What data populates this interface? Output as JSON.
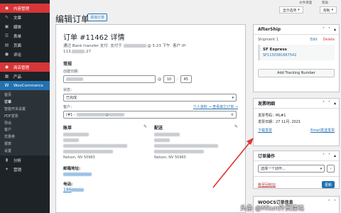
{
  "top_links": [
    "文件清理",
    "帮助"
  ],
  "screen_options_label": "显示选项",
  "help_label": "帮助",
  "sidebar": {
    "items_top": [
      {
        "label": "内容管理",
        "icon": "dashboard-icon",
        "state": "active"
      },
      {
        "label": "文章",
        "icon": "pin-icon"
      },
      {
        "label": "媒体",
        "icon": "media-icon"
      },
      {
        "label": "表单",
        "icon": "form-icon"
      },
      {
        "label": "页面",
        "icon": "page-icon"
      },
      {
        "label": "评论",
        "icon": "comment-icon"
      },
      {
        "label": "商店管理",
        "icon": "store-icon",
        "state": "active"
      },
      {
        "label": "产品",
        "icon": "product-icon"
      },
      {
        "label": "WooCommerce",
        "icon": "woocommerce-icon",
        "state": "woo"
      }
    ],
    "sub_items": [
      "首页",
      "订单",
      "智能开关设置",
      "PDF发票",
      "导出",
      "客户",
      "优惠券",
      "报表",
      "设置"
    ],
    "current_sub": "订单",
    "items_bottom": [
      {
        "label": "分析",
        "icon": "analytics-icon"
      },
      {
        "label": "营销",
        "icon": "marketing-icon"
      }
    ]
  },
  "page": {
    "title": "编辑订单",
    "add_button": "添加订单",
    "order_title": "订单 #11462 详情",
    "meta_line1_prefix": "通过 Bank transfer 支付. 支付于",
    "meta_line1_suffix": "@ 5:23 下午. 客户 IP:",
    "meta_line2_prefix": "113.",
    "meta_line2_suffix": ".27",
    "general_heading": "常规",
    "created_label": "创建日期：",
    "at_sign": "@",
    "hour": "10",
    "minute": "45",
    "status_label": "状态：",
    "status_value": "已完成",
    "customer_label": "客户：",
    "customer_links": "个人资料 → 查看其它订单 →",
    "customer_prefix": "(#1 –",
    "customer_suffix": "@",
    "billing_heading": "账单",
    "shipping_heading": "配送",
    "billing_city": "Nelson, NV 50965",
    "shipping_city": "Nelson, NV 50965",
    "email_label": "邮箱地址:",
    "phone_label": "电话:",
    "phone_value": "186"
  },
  "aftership": {
    "title": "AfterShip",
    "shipment_label": "Shipment 1",
    "edit": "Edit",
    "delete": "Delete",
    "carrier": "SF Express",
    "tracking": "SF1130381667542",
    "add_button": "Add Tracking Number"
  },
  "invoice": {
    "title": "发票明细",
    "number": "发票号码：ML#1",
    "date": "发票日期：27 11月, 2021",
    "download": "下载发票",
    "email": "Email发送发票"
  },
  "order_actions": {
    "title": "订单操作",
    "select": "选择一个动作...",
    "move_trash": "移至回收站",
    "update": "更新"
  },
  "woocs": {
    "title": "WOOCS订单信息"
  },
  "watermark": "头条 @Mkun外贸建站"
}
